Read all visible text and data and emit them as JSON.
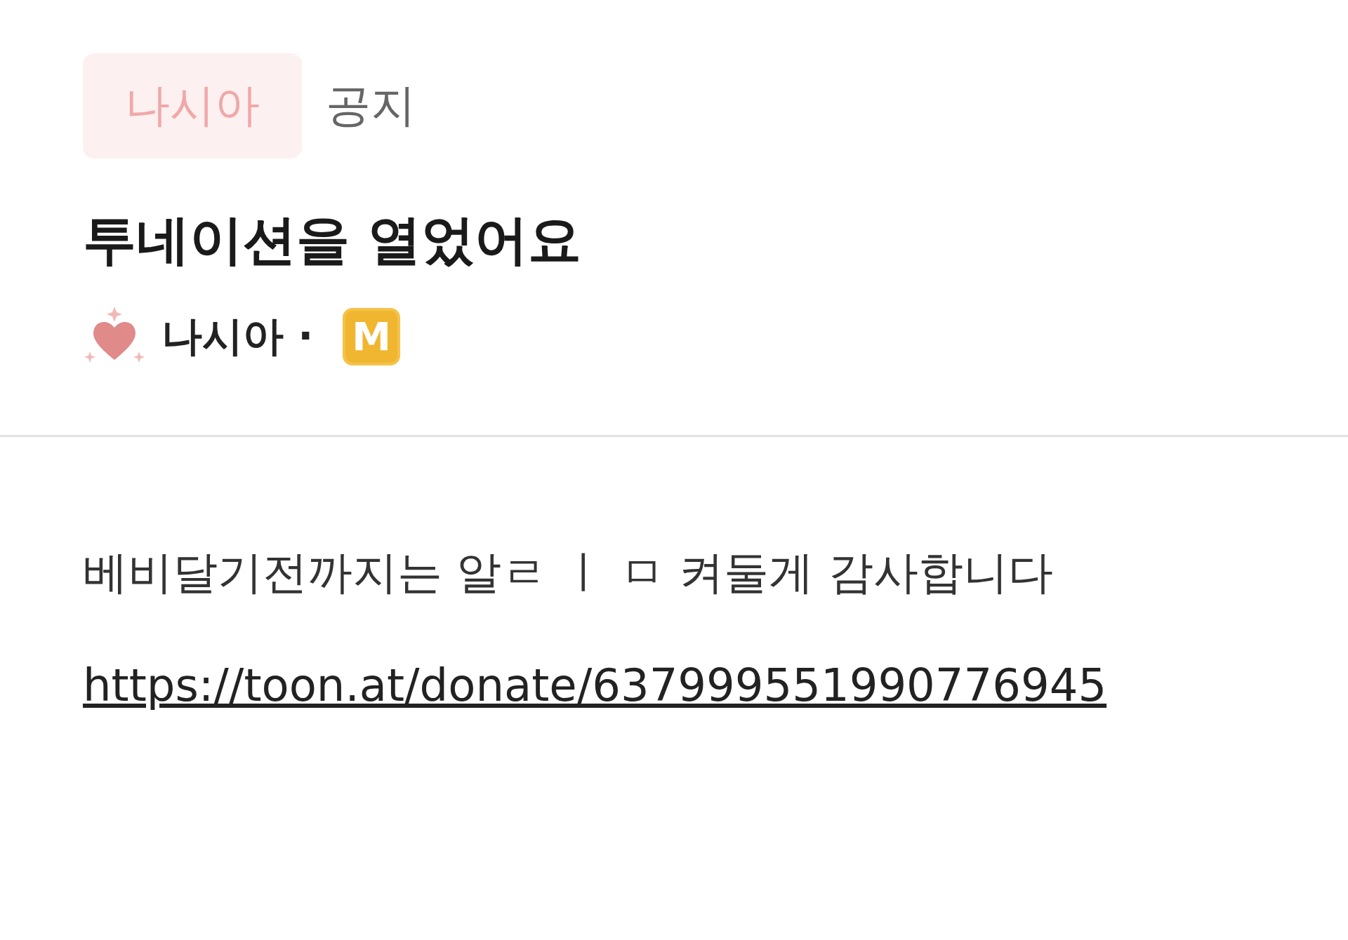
{
  "tabs": [
    {
      "label": "나시아",
      "selected": true
    },
    {
      "label": "공지",
      "selected": false
    }
  ],
  "post": {
    "title": "투네이션을 열었어요",
    "author": "나시아 ·",
    "badge": "M"
  },
  "body": {
    "text": "베비달기전까지는 알ㄹ ㅣ ㅁ 켜둘게 감사합니다",
    "link": "https://toon.at/donate/637999551990776945"
  }
}
